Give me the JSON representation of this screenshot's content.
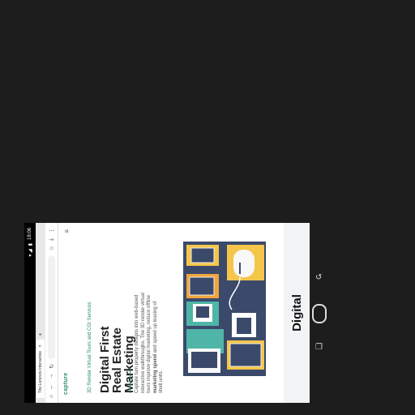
{
  "status": {
    "time": "18:06",
    "signal": "▾ ◢",
    "battery": "▮"
  },
  "browser": {
    "tab_title": "Tito Lorenzo Interactive",
    "new_tab": "+"
  },
  "site": {
    "logo": "capture",
    "kicker": "3D Render Virtual Tours and CGI Services",
    "heading_line1": "Digital First",
    "heading_line2": "Real Estate Marketing",
    "body_pre": "Captate turn property designs into web-based interactive walkthroughs. The 3D render virtual tours improve digital marketing, reduce offline ",
    "body_bold": "marketing spend",
    "body_post": " and speed up leasing of shell units.",
    "lower_title": "Digital"
  },
  "colors": {
    "accent": "#2a8c6b",
    "navy": "#3b4a6b",
    "yellow": "#f5c64a",
    "teal": "#4fb6a7"
  }
}
